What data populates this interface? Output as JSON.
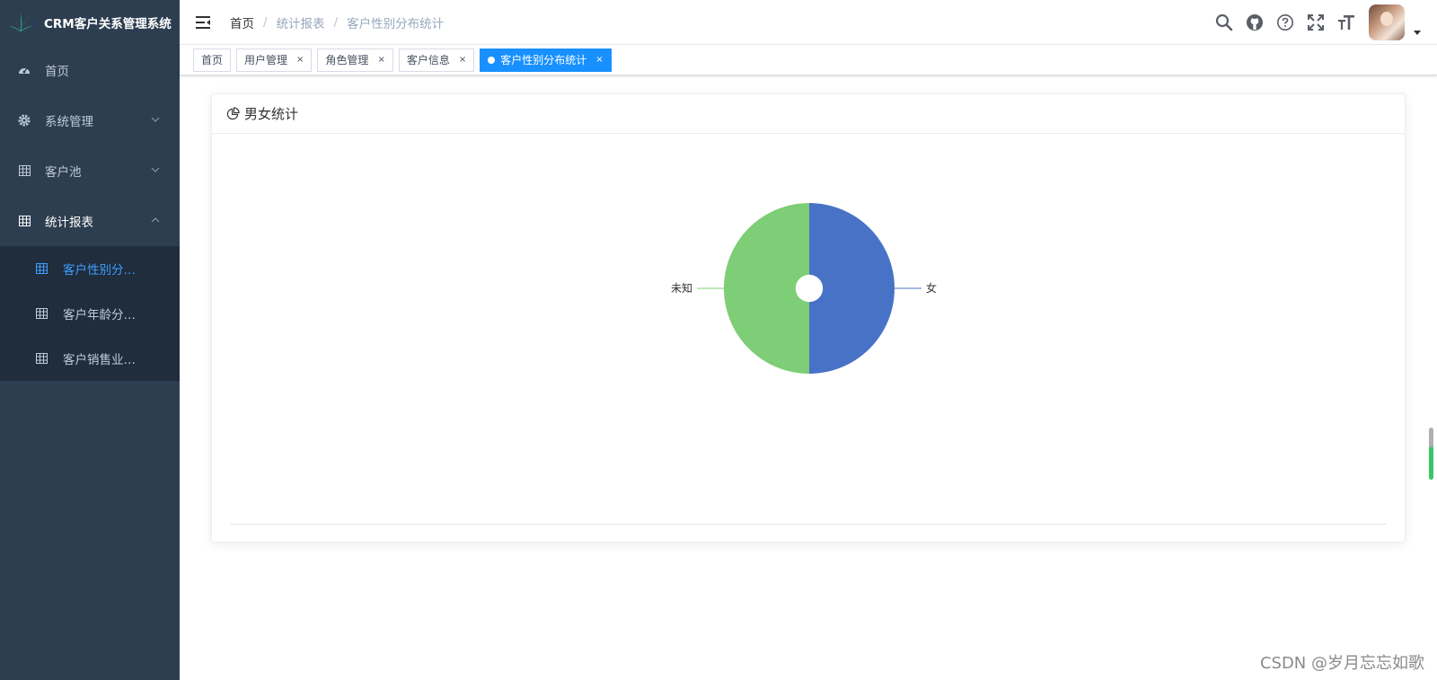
{
  "app": {
    "title": "CRM客户关系管理系统"
  },
  "sidebar": {
    "items": [
      {
        "label": "首页",
        "icon": "dashboard-icon"
      },
      {
        "label": "系统管理",
        "icon": "gear-icon"
      },
      {
        "label": "客户池",
        "icon": "table-icon"
      },
      {
        "label": "统计报表",
        "icon": "table-icon"
      }
    ],
    "subitems": [
      {
        "label": "客户性别分…",
        "icon": "table-icon",
        "active": true
      },
      {
        "label": "客户年龄分…",
        "icon": "table-icon"
      },
      {
        "label": "客户销售业…",
        "icon": "table-icon"
      }
    ]
  },
  "breadcrumb": {
    "items": [
      "首页",
      "统计报表",
      "客户性别分布统计"
    ],
    "separator": "/"
  },
  "tags": [
    {
      "label": "首页"
    },
    {
      "label": "用户管理"
    },
    {
      "label": "角色管理"
    },
    {
      "label": "客户信息"
    },
    {
      "label": "客户性别分布统计",
      "active": true
    }
  ],
  "tag_close": "×",
  "card": {
    "title": "男女统计"
  },
  "chart_data": {
    "type": "pie",
    "title": "",
    "slices": [
      {
        "name": "女",
        "value": 50,
        "color": "#4872c6"
      },
      {
        "name": "未知",
        "value": 50,
        "color": "#7ecd77"
      }
    ],
    "start_angle_deg": 0,
    "inner_radius_ratio": 0.16
  },
  "watermark": "CSDN @岁月忘忘如歌",
  "colors": {
    "sidebar_bg": "#2d3e50",
    "submenu_bg": "#1f2d3d",
    "active_menu": "#409eff",
    "active_tag": "#1890ff"
  }
}
